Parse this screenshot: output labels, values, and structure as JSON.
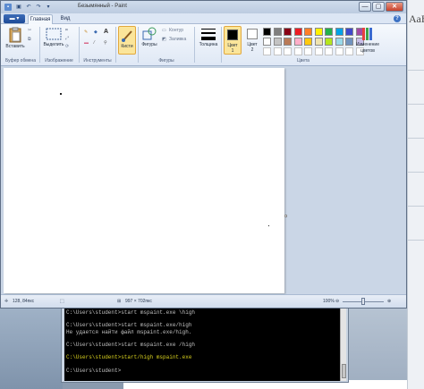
{
  "window": {
    "title": "Безымянный - Paint",
    "minimize_label": "—",
    "maximize_label": "▢",
    "close_label": "✕"
  },
  "tabs": {
    "menu_label": "▬ ▾",
    "home": "Главная",
    "view": "Вид"
  },
  "ribbon": {
    "clipboard": {
      "paste": "Вставить",
      "group": "Буфер обмена"
    },
    "image": {
      "select": "Выделить",
      "group": "Изображение"
    },
    "tools": {
      "group": "Инструменты"
    },
    "brushes": {
      "label": "Кисти"
    },
    "shapes": {
      "label": "Фигуры",
      "outline": "Контур",
      "fill": "Заливка",
      "group": "Фигуры"
    },
    "size": {
      "label": "Толщина"
    },
    "color1": {
      "label": "Цвет",
      "num": "1"
    },
    "color2": {
      "label": "Цвет",
      "num": "2"
    },
    "edit_colors": {
      "line1": "Изменение",
      "line2": "цветов"
    },
    "colors_group": "Цвета",
    "palette_row1": [
      "#000000",
      "#7f7f7f",
      "#880015",
      "#ed1c24",
      "#ff7f27",
      "#fff200",
      "#22b14c",
      "#00a2e8",
      "#3f48cc",
      "#a349a4"
    ],
    "palette_row2": [
      "#ffffff",
      "#c3c3c3",
      "#b97a57",
      "#ffaec9",
      "#ffc90e",
      "#efe4b0",
      "#b5e61d",
      "#99d9ea",
      "#7092be",
      "#c8bfe7"
    ]
  },
  "status": {
    "cursor_pos": "128, 84пкс",
    "canvas_size": "997 × 702пкс",
    "zoom": "100%",
    "zoom_minus": "⊖",
    "zoom_plus": "⊕"
  },
  "console": {
    "lines": [
      {
        "text": "C:\\Users\\student>start mspaint.exe \\high",
        "highlight": false
      },
      {
        "text": "",
        "highlight": false
      },
      {
        "text": "C:\\Users\\student>start mspaint.exe/high",
        "highlight": false
      },
      {
        "text": "Не удается найти файл mspaint.exe/high.",
        "highlight": false
      },
      {
        "text": "",
        "highlight": false
      },
      {
        "text": "C:\\Users\\student>start mspaint.exe /high",
        "highlight": false
      },
      {
        "text": "",
        "highlight": false
      },
      {
        "text": "C:\\Users\\student>start/high mspaint.exe",
        "highlight": true
      },
      {
        "text": "",
        "highlight": false
      },
      {
        "text": "C:\\Users\\student>",
        "highlight": false
      }
    ]
  },
  "desktop": {
    "corner_text": "АаБ"
  }
}
